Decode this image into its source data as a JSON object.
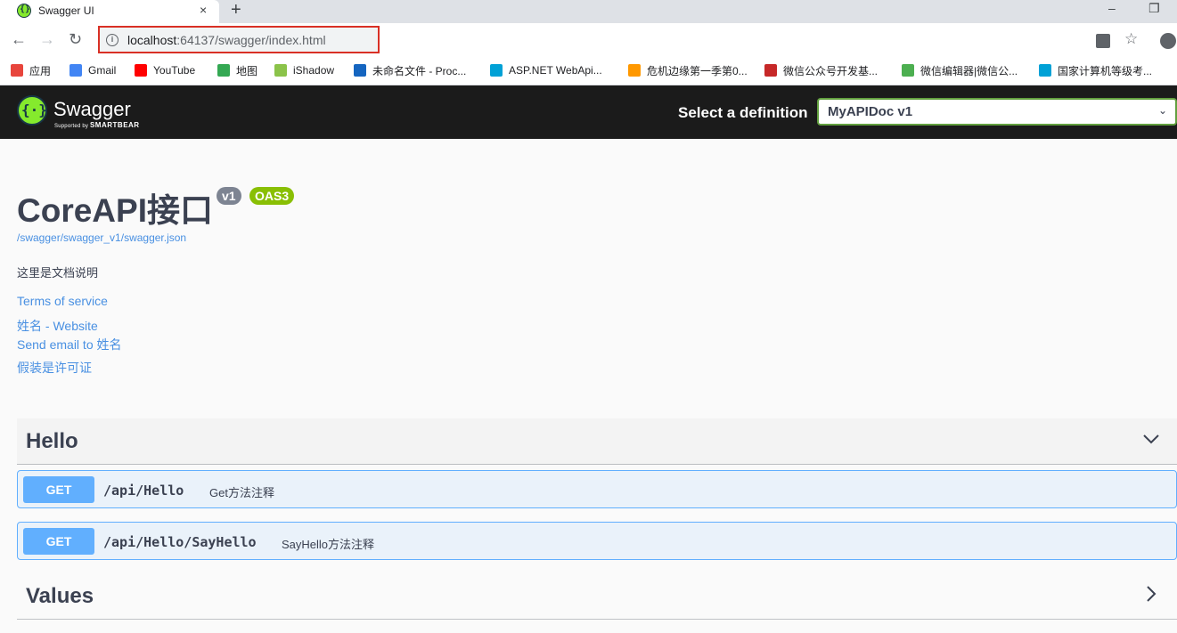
{
  "browser": {
    "tab_title": "Swagger UI",
    "tab_close": "×",
    "new_tab": "+",
    "url_host": "localhost",
    "url_rest": ":64137/swagger/index.html",
    "minimize": "–",
    "restore": "❐",
    "bookmarks": [
      {
        "label": "应用",
        "color": "#e8453c"
      },
      {
        "label": "Gmail",
        "color": "#4285f4"
      },
      {
        "label": "YouTube",
        "color": "#ff0000"
      },
      {
        "label": "地图",
        "color": "#34a853"
      },
      {
        "label": "iShadow",
        "color": "#8bc34a"
      },
      {
        "label": "未命名文件 - Proc...",
        "color": "#1565c0"
      },
      {
        "label": "ASP.NET WebApi...",
        "color": "#00a1d6"
      },
      {
        "label": "危机边缘第一季第0...",
        "color": "#ff9800"
      },
      {
        "label": "微信公众号开发基...",
        "color": "#c62828"
      },
      {
        "label": "微信编辑器|微信公...",
        "color": "#4caf50"
      },
      {
        "label": "国家计算机等级考...",
        "color": "#00a1d6"
      }
    ]
  },
  "swagger": {
    "logo_text": "Swagger",
    "logo_sub_prefix": "Supported by ",
    "logo_sub_brand": "SMARTBEAR",
    "definition_label": "Select a definition",
    "definition_value": "MyAPIDoc v1"
  },
  "info": {
    "title": "CoreAPI接口",
    "version_badge": "v1",
    "oas_badge": "OAS3",
    "spec_url": "/swagger/swagger_v1/swagger.json",
    "description": "这里是文档说明",
    "terms": "Terms of service",
    "website": "姓名 - Website",
    "email": "Send email to 姓名",
    "license": "假装是许可证"
  },
  "tags": [
    {
      "name": "Hello",
      "operations": [
        {
          "method": "GET",
          "path": "/api/Hello",
          "summary": "Get方法注释"
        },
        {
          "method": "GET",
          "path": "/api/Hello/SayHello",
          "summary": "SayHello方法注释"
        }
      ]
    },
    {
      "name": "Values",
      "operations": []
    }
  ]
}
